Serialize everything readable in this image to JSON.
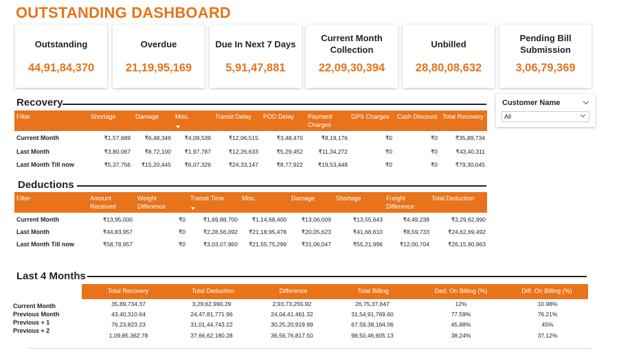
{
  "title": "OUTSTANDING DASHBOARD",
  "kpis": [
    {
      "label": "Outstanding",
      "value": "44,91,84,370"
    },
    {
      "label": "Overdue",
      "value": "21,19,95,169"
    },
    {
      "label": "Due In Next 7 Days",
      "value": "5,91,47,881"
    },
    {
      "label": "Current Month Collection",
      "value": "22,09,30,394"
    },
    {
      "label": "Unbilled",
      "value": "28,80,08,632"
    },
    {
      "label": "Pending Bill Submission",
      "value": "3,06,79,369"
    }
  ],
  "slicer": {
    "title": "Customer Name",
    "value": "All"
  },
  "recovery": {
    "title": "Recovery",
    "headers": [
      "Filter",
      "Shortage",
      "Damage",
      "Misc.",
      "Transit Delay",
      "POD Delay",
      "Payment Charges",
      "GPS Charges",
      "Cash Discount",
      "Total Recovery"
    ],
    "rows": [
      {
        "label": "Current Month",
        "cells": [
          "₹1,57,689",
          "₹6,48,346",
          "₹4,09,539",
          "₹12,06,515",
          "₹3,48,470",
          "₹8,19,176",
          "₹0",
          "₹0",
          "₹35,89,734"
        ]
      },
      {
        "label": "Last Month",
        "cells": [
          "₹3,80,067",
          "₹8,72,100",
          "₹1,97,787",
          "₹12,26,633",
          "₹5,29,452",
          "₹11,34,272",
          "₹0",
          "₹0",
          "₹43,40,311"
        ]
      },
      {
        "label": "Last Month Till now",
        "cells": [
          "₹5,37,756",
          "₹15,20,445",
          "₹6,07,326",
          "₹24,33,147",
          "₹8,77,922",
          "₹19,53,448",
          "₹0",
          "₹0",
          "₹79,30,045"
        ]
      }
    ]
  },
  "deductions": {
    "title": "Deductions",
    "headers": [
      "Filter",
      "Amount Received",
      "Weight Difference",
      "Transit Time",
      "Misc.",
      "Damage",
      "Shortage",
      "Freight Difference",
      "Total Deduction"
    ],
    "rows": [
      {
        "label": "Current Month",
        "cells": [
          "₹13,95,000",
          "₹0",
          "₹1,69,88,700",
          "₹1,14,68,400",
          "₹13,06,009",
          "₹13,55,643",
          "₹4,49,238",
          "₹3,29,62,990"
        ]
      },
      {
        "label": "Last Month",
        "cells": [
          "₹44,83,957",
          "₹0",
          "₹2,28,56,092",
          "₹21,18,95,478",
          "₹20,05,623",
          "₹41,68,610",
          "₹8,59,733",
          "₹24,62,69,492"
        ]
      },
      {
        "label": "Last Month Till now",
        "cells": [
          "₹58,78,957",
          "₹0",
          "₹3,03,07,960",
          "₹21,55,75,299",
          "₹31,06,047",
          "₹55,21,996",
          "₹12,00,704",
          "₹26,15,90,963"
        ]
      }
    ]
  },
  "last4": {
    "title": "Last 4 Months",
    "headers": [
      "Total Recovery",
      "Total Deduction",
      "Difference",
      "Total Billing",
      "Ded. On Billing (%)",
      "Diff. On Billing (%)"
    ],
    "labels": [
      "Current Month",
      "Previous Month",
      "Previous + 1",
      "Previous + 2"
    ],
    "rows": [
      [
        "35,89,734.37",
        "3,29,62,990.29",
        "2,93,73,255.92",
        "26,75,37,647",
        "12%",
        "10.98%"
      ],
      [
        "43,40,310.64",
        "24,47,81,771.96",
        "24,04,41,461.32",
        "31,54,91,769.60",
        "77.59%",
        "76.21%"
      ],
      [
        "76,23,823.23",
        "31,01,44,743.22",
        "30,25,20,919.99",
        "67,59,38,164.06",
        "45.88%",
        "45%"
      ],
      [
        "1,09,85,362.78",
        "37,66,62,180.28",
        "36,56,76,817.50",
        "98,50,46,605.13",
        "38.24%",
        "37.12%"
      ]
    ]
  },
  "colors": {
    "accent": "#E8731A"
  }
}
